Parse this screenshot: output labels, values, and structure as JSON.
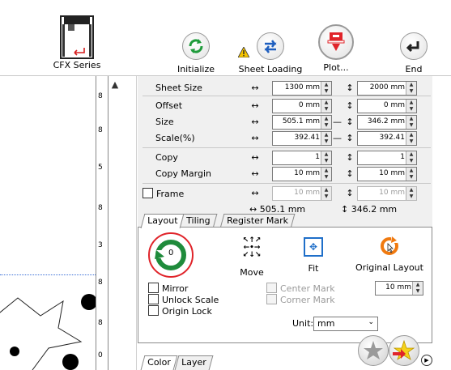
{
  "window": {
    "close_label": "×"
  },
  "toolbar": {
    "device_label": "CFX Series",
    "initialize_label": "Initialize",
    "sheet_loading_label": "Sheet Loading",
    "plot_label": "Plot...",
    "end_label": "End"
  },
  "ruler": {
    "labels": [
      "8",
      "0",
      "8",
      "5",
      "8",
      "3",
      "8",
      "8"
    ]
  },
  "panel": {
    "rows": [
      {
        "label": "Sheet Size",
        "v1": "1300 mm",
        "v2": "2000 mm"
      },
      {
        "label": "Offset",
        "v1": "0 mm",
        "v2": "0 mm"
      },
      {
        "label": "Size",
        "v1": "505.1 mm",
        "v2": "346.2 mm"
      },
      {
        "label": "Scale(%)",
        "v1": "392.41",
        "v2": "392.41"
      },
      {
        "label": "Copy",
        "v1": "1",
        "v2": "1"
      },
      {
        "label": "Copy Margin",
        "v1": "10 mm",
        "v2": "10 mm"
      },
      {
        "label": "Frame",
        "v1": "10 mm",
        "v2": "10 mm"
      }
    ],
    "horiz_arrow": "↔",
    "vert_arrow": "↕",
    "link_dash": "—",
    "summary_w": "↔ 505.1 mm",
    "summary_h": "↕ 346.2 mm"
  },
  "tabs": {
    "layout": "Layout",
    "tiling": "Tiling",
    "register": "Register Mark"
  },
  "layout": {
    "rotate_value": "0",
    "move_label": "Move",
    "fit_label": "Fit",
    "original_layout_label": "Original Layout",
    "mirror": "Mirror",
    "unlock_scale": "Unlock Scale",
    "origin_lock": "Origin Lock",
    "center_mark": "Center Mark",
    "corner_mark": "Corner Mark",
    "margin_value": "10 mm",
    "unit_label": "Unit:",
    "unit_value": "mm"
  },
  "bottom_tabs": {
    "color": "Color",
    "layer": "Layer"
  }
}
